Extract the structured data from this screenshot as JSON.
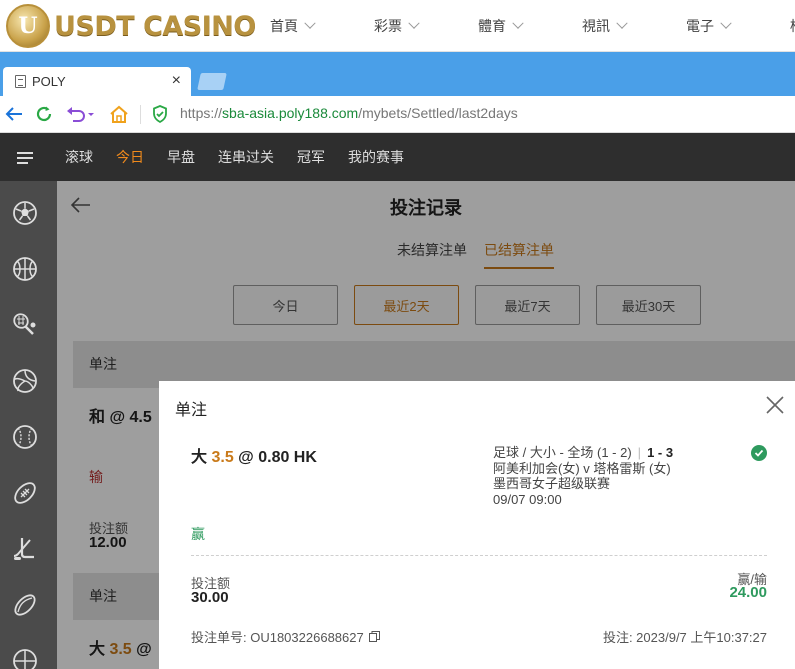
{
  "site": {
    "logo_text": "USDT CASINO",
    "logo_badge": "U",
    "nav": [
      "首頁",
      "彩票",
      "體育",
      "視訊",
      "電子",
      "棋"
    ]
  },
  "browser": {
    "tab_title": "POLY",
    "tab_close": "×",
    "url_scheme": "https://",
    "url_host": "sba-asia.poly188.com",
    "url_path": "/mybets/Settled/last2days"
  },
  "app_nav": {
    "items": [
      "滚球",
      "今日",
      "早盘",
      "连串过关",
      "冠军",
      "我的赛事"
    ],
    "active_index": 1
  },
  "sidebar": {
    "icons": [
      "soccer-icon",
      "basketball-icon",
      "tennis-icon",
      "volleyball-icon",
      "baseball-icon",
      "american-football-icon",
      "ice-hockey-icon",
      "rugby-icon",
      "more-sports-icon"
    ]
  },
  "page": {
    "title": "投注记录",
    "tabs": [
      "未结算注单",
      "已结算注单"
    ],
    "active_tab": 1,
    "ranges": [
      "今日",
      "最近2天",
      "最近7天",
      "最近30天"
    ],
    "active_range": 1
  },
  "background": {
    "card1_head": "单注",
    "card1_selection": "和 @ 4.5",
    "card1_result": "输",
    "card1_stake_label": "投注额",
    "card1_stake": "12.00",
    "card2_head": "单注",
    "card2_selection_pre": "大 ",
    "card2_selection_hc": "3.5",
    "card2_selection_post": " @"
  },
  "modal": {
    "title": "单注",
    "selection_side": "大",
    "handicap": "3.5",
    "odds": "@  0.80 HK",
    "market": "足球 / 大小 - 全场 (1 - 2)",
    "separator": "|",
    "final_score": "1 - 3",
    "teams": "阿美利加会(女) v 塔格雷斯 (女)",
    "league": "墨西哥女子超级联赛",
    "kickoff": "09/07 09:00",
    "result": "赢",
    "stake_label": "投注额",
    "stake": "30.00",
    "pl_label": "赢/输",
    "pl": "24.00",
    "ticket": "投注单号: OU1803226688627",
    "placed": "投注: 2023/9/7 上午10:37:27"
  }
}
